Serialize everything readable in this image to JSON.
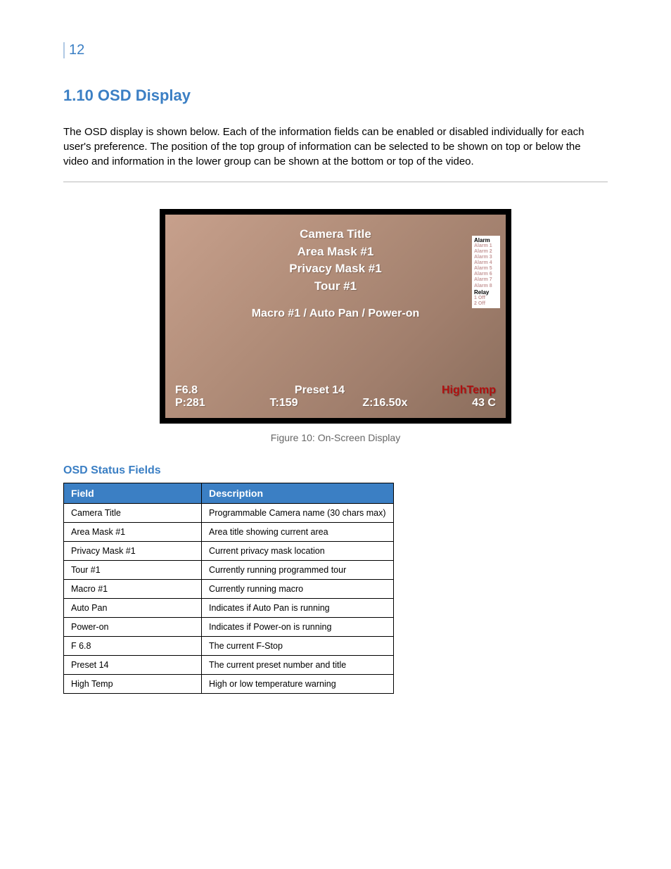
{
  "page_number": "12",
  "section_title": "1.10 OSD Display",
  "paragraph": "The OSD display is shown below. Each of the information fields can be enabled or disabled individually for each user's preference. The position of the top group of information can be selected to be shown on top or below the video and information in the lower group can be shown at the bottom or top of the video.",
  "screenshot": {
    "center_lines": [
      "Camera Title",
      "Area Mask #1",
      "Privacy Mask #1",
      "Tour #1"
    ],
    "center_wide": "Macro #1 / Auto Pan / Power-on",
    "alarm_box": {
      "header": "Alarm",
      "alarms": [
        "Alarm 1",
        "Alarm 2",
        "Alarm 3",
        "Alarm 4",
        "Alarm 5",
        "Alarm 6",
        "Alarm 7",
        "Alarm 8"
      ],
      "relay_header": "Relay",
      "relays": [
        "1 Off",
        "2 Off"
      ]
    },
    "bottom_row1": {
      "left": "F6.8",
      "center": "Preset 14",
      "right": "HighTemp"
    },
    "bottom_row2": {
      "pan": "P:281",
      "tilt": "T:159",
      "zoom": "Z:16.50x",
      "temp": "43 C"
    }
  },
  "figure_caption": "Figure 10: On-Screen Display",
  "sub_title": "OSD Status Fields",
  "table": {
    "headers": [
      "Field",
      "Description"
    ],
    "rows": [
      [
        "Camera Title",
        "Programmable Camera name (30 chars max)"
      ],
      [
        "Area Mask #1",
        "Area title showing current area"
      ],
      [
        "Privacy Mask #1",
        "Current privacy mask location"
      ],
      [
        "Tour #1",
        "Currently running programmed tour"
      ],
      [
        "Macro #1",
        "Currently running macro"
      ],
      [
        "Auto Pan",
        "Indicates if Auto Pan is running"
      ],
      [
        "Power-on",
        "Indicates if Power-on is running"
      ],
      [
        "F 6.8",
        "The current F-Stop"
      ],
      [
        "Preset 14",
        "The current preset number and title"
      ],
      [
        "High Temp",
        "High or low temperature warning"
      ]
    ]
  }
}
